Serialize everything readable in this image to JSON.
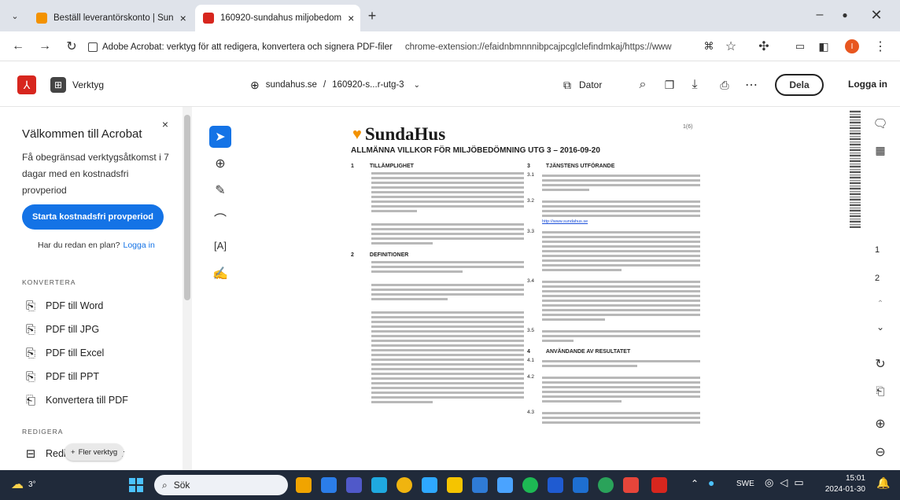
{
  "browser": {
    "tabs": [
      {
        "title": "Beställ leverantörskonto | Sun",
        "active": false
      },
      {
        "title": "160920-sundahus miljobedom",
        "active": true
      }
    ],
    "new_tab": "+",
    "address_prefix": "Adobe Acrobat: verktyg för att redigera, konvertera och signera PDF-filer",
    "address_url": "chrome-extension://efaidnbmnnnibpcajpcglclefindmkaj/https://www",
    "profile_initial": "I"
  },
  "acrobat": {
    "tools_label": "Verktyg",
    "breadcrumb_site": "sundahus.se",
    "breadcrumb_sep": "/",
    "breadcrumb_file": "160920-s...r-utg-3",
    "device_label": "Dator",
    "share_label": "Dela",
    "login_label": "Logga in"
  },
  "panel": {
    "title": "Välkommen till Acrobat",
    "description": "Få obegränsad verktygsåtkomst i 7 dagar med en kostnadsfri provperiod",
    "trial_button": "Starta kostnadsfri provperiod",
    "have_plan": "Har du redan en plan?",
    "login_link": "Logga in",
    "convert_header": "KONVERTERA",
    "convert_items": [
      "PDF till Word",
      "PDF till JPG",
      "PDF till Excel",
      "PDF till PPT",
      "Konvertera till PDF"
    ],
    "edit_header": "REDIGERA",
    "edit_item_prefix": "Redi",
    "edit_item_suffix": "lder",
    "more_tools": "Fler verktyg"
  },
  "document": {
    "logo": "SundaHus",
    "page_tag": "1(6)",
    "heading": "ALLMÄNNA VILLKOR FÖR MILJÖBEDÖMNING UTG 3 – 2016-09-20",
    "sec1_num": "1",
    "sec1_title": "TILLÄMPLIGHET",
    "sec2_num": "2",
    "sec2_title": "DEFINITIONER",
    "sec3_num": "3",
    "sec3_title": "TJÄNSTENS UTFÖRANDE",
    "sec4_num": "4",
    "sec4_title": "ANVÄNDANDE AV RESULTATET",
    "sub_31": "3.1",
    "sub_32": "3.2",
    "sub_33": "3.3",
    "sub_34": "3.4",
    "sub_35": "3.5",
    "sub_41": "4.1",
    "sub_42": "4.2",
    "sub_43": "4.3",
    "link_text": "http://www.sundahus.se"
  },
  "rightrail": {
    "page1": "1",
    "page2": "2"
  },
  "taskbar": {
    "search_label": "Sök",
    "lang": "SWE",
    "time": "15:01",
    "date": "2024-01-30",
    "weather": "3°"
  },
  "colors": {
    "accent_red": "#d7261e",
    "share_border": "#222222",
    "trial_blue": "#1473e6",
    "taskbar": "#202a3a",
    "logo_orange": "#f39200"
  }
}
